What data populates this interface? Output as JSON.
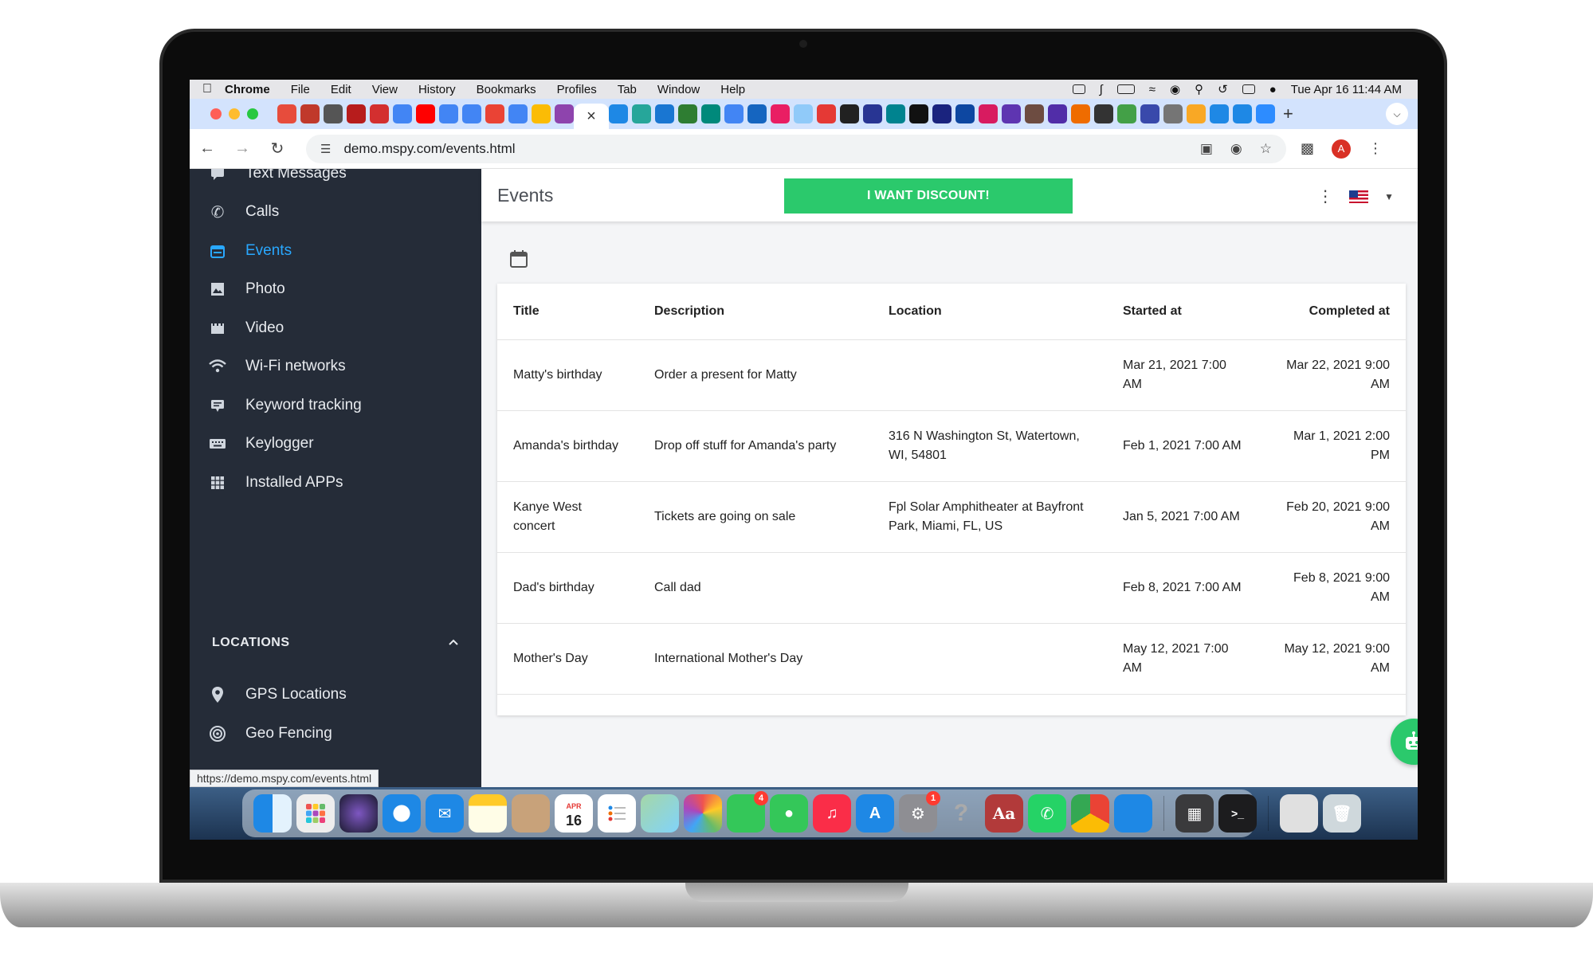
{
  "menubar": {
    "app": "Chrome",
    "items": [
      "File",
      "Edit",
      "View",
      "History",
      "Bookmarks",
      "Profiles",
      "Tab",
      "Window",
      "Help"
    ],
    "clock": "Tue Apr 16  11:44 AM"
  },
  "browser": {
    "url": "demo.mspy.com/events.html",
    "profile_initial": "A",
    "status_url": "https://demo.mspy.com/events.html"
  },
  "sidebar": {
    "items": [
      {
        "label": "Text Messages",
        "icon": "chat-icon"
      },
      {
        "label": "Calls",
        "icon": "phone-icon"
      },
      {
        "label": "Events",
        "icon": "calendar-icon"
      },
      {
        "label": "Photo",
        "icon": "image-icon"
      },
      {
        "label": "Video",
        "icon": "video-icon"
      },
      {
        "label": "Wi-Fi networks",
        "icon": "wifi-icon"
      },
      {
        "label": "Keyword tracking",
        "icon": "keyword-icon"
      },
      {
        "label": "Keylogger",
        "icon": "keyboard-icon"
      },
      {
        "label": "Installed APPs",
        "icon": "apps-grid-icon"
      }
    ],
    "section": "LOCATIONS",
    "location_items": [
      {
        "label": "GPS Locations",
        "icon": "pin-icon"
      },
      {
        "label": "Geo Fencing",
        "icon": "target-icon"
      }
    ]
  },
  "header": {
    "title": "Events",
    "discount_label": "I WANT DISCOUNT!"
  },
  "table": {
    "columns": [
      "Title",
      "Description",
      "Location",
      "Started at",
      "Completed at"
    ],
    "rows": [
      [
        "Matty's birthday",
        "Order a present for Matty",
        "",
        "Mar 21, 2021 7:00 AM",
        "Mar 22, 2021 9:00 AM"
      ],
      [
        "Amanda's birthday",
        "Drop off stuff for Amanda's party",
        "316 N Washington St, Watertown, WI, 54801",
        "Feb 1, 2021 7:00 AM",
        "Mar 1, 2021 2:00 PM"
      ],
      [
        "Kanye West concert",
        "Tickets are going on sale",
        "Fpl Solar Amphitheater at Bayfront Park, Miami, FL, US",
        "Jan 5, 2021 7:00 AM",
        "Feb 20, 2021 9:00 AM"
      ],
      [
        "Dad's birthday",
        "Call dad",
        "",
        "Feb 8, 2021 7:00 AM",
        "Feb 8, 2021 9:00 AM"
      ],
      [
        "Mother's Day",
        "International Mother's Day",
        "",
        "May 12, 2021 7:00 AM",
        "May 12, 2021 9:00 AM"
      ]
    ]
  },
  "dock": {
    "calendar_month": "APR",
    "calendar_day": "16",
    "facetime_badge": "4",
    "settings_badge": "1",
    "dictionary_label": "Aa"
  },
  "colors": {
    "sidebar_bg": "#252c38",
    "active": "#29a8ff",
    "discount": "#2bc96c"
  }
}
